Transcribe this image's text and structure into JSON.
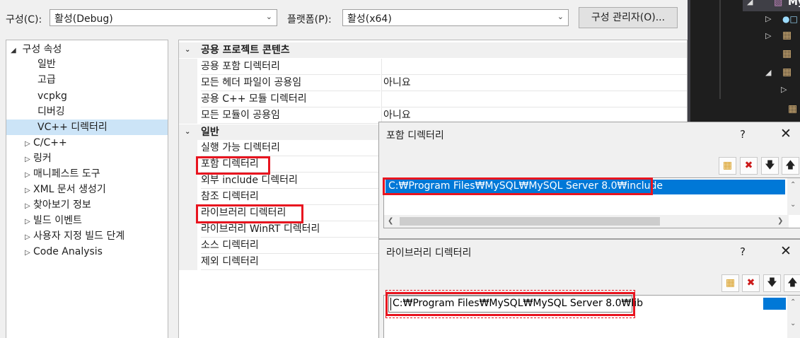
{
  "toolbar": {
    "config_label": "구성(C):",
    "config_value": "활성(Debug)",
    "platform_label": "플랫폼(P):",
    "platform_value": "활성(x64)",
    "config_manager_button": "구성 관리자(O)..."
  },
  "tree": {
    "root": "구성 속성",
    "items": [
      {
        "label": "일반"
      },
      {
        "label": "고급"
      },
      {
        "label": "vcpkg"
      },
      {
        "label": "디버깅"
      },
      {
        "label": "VC++ 디렉터리",
        "selected": true
      },
      {
        "label": "C/C++",
        "expandable": true
      },
      {
        "label": "링커",
        "expandable": true
      },
      {
        "label": "매니페스트 도구",
        "expandable": true
      },
      {
        "label": "XML 문서 생성기",
        "expandable": true
      },
      {
        "label": "찾아보기 정보",
        "expandable": true
      },
      {
        "label": "빌드 이벤트",
        "expandable": true
      },
      {
        "label": "사용자 지정 빌드 단계",
        "expandable": true
      },
      {
        "label": "Code Analysis",
        "expandable": true
      }
    ]
  },
  "grid": {
    "cat1": "공용 프로젝트 콘텐츠",
    "cat1_rows": [
      {
        "name": "공용 포함 디렉터리",
        "value": ""
      },
      {
        "name": "모든 헤더 파일이 공용임",
        "value": "아니요"
      },
      {
        "name": "공용 C++ 모듈 디렉터리",
        "value": ""
      },
      {
        "name": "모든 모듈이 공용임",
        "value": "아니요"
      }
    ],
    "cat2": "일반",
    "cat2_rows": [
      {
        "name": "실행 가능 디렉터리",
        "value": ""
      },
      {
        "name": "포함 디렉터리",
        "value": ""
      },
      {
        "name": "외부 include 디렉터리",
        "value": ""
      },
      {
        "name": "참조 디렉터리",
        "value": ""
      },
      {
        "name": "라이브러리 디렉터리",
        "value": ""
      },
      {
        "name": "라이브러리 WinRT 디렉터리",
        "value": ""
      },
      {
        "name": "소스 디렉터리",
        "value": ""
      },
      {
        "name": "제외 디렉터리",
        "value": ""
      }
    ]
  },
  "include_dialog": {
    "title": "포함 디렉터리",
    "help": "?",
    "close": "✕",
    "entry": "C:₩Program Files₩MySQL₩MySQL Server 8.0₩include"
  },
  "library_dialog": {
    "title": "라이브러리 디렉터리",
    "help": "?",
    "close": "✕",
    "entry": "C:₩Program Files₩MySQL₩MySQL Server 8.0₩lib"
  },
  "dark_panel": {
    "partial_title": "My"
  },
  "colors": {
    "highlight": "#e8141f",
    "selection": "#0078d7",
    "tree_selection": "#cce4f7"
  }
}
